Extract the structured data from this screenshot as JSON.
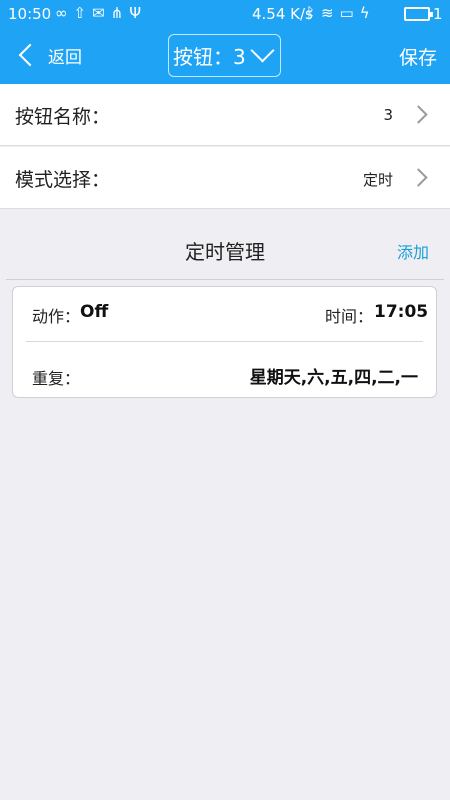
{
  "status_bar": {
    "time": "10:50",
    "speed": "4.54 K/s",
    "battery": "1",
    "left_icons": [
      "infinity-icon",
      "upload-icon",
      "mail-icon",
      "share-icon",
      "usb-icon"
    ],
    "right_icons": [
      "bluetooth-icon",
      "wifi-icon",
      "screen-icon",
      "charging-icon",
      "battery-icon"
    ]
  },
  "header": {
    "back_label": "返回",
    "title": "按钮：3",
    "save_label": "保存",
    "background_color": "#1fa3f4"
  },
  "rows": [
    {
      "label": "按钮名称：",
      "value": "3"
    },
    {
      "label": "模式选择：",
      "value": "定时"
    }
  ],
  "timer_section": {
    "title": "定时管理",
    "add_label": "添加",
    "accent_color": "#1a9ed8",
    "card": {
      "action_label": "动作：",
      "action_value": "Off",
      "time_label": "时间：",
      "time_value": "17:05",
      "repeat_label": "重复：",
      "repeat_value": "星期天,六,五,四,二,一"
    }
  }
}
